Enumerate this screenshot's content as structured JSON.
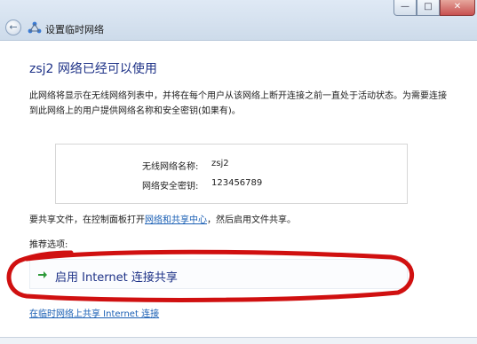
{
  "window": {
    "title": "设置临时网络",
    "controls": {
      "minimize": "—",
      "maximize": "□",
      "close": "✕"
    }
  },
  "content": {
    "heading": "zsj2 网络已经可以使用",
    "paragraph": "此网络将显示在无线网络列表中，并将在每个用户从该网络上断开连接之前一直处于活动状态。为需要连接到此网络上的用户提供网络名称和安全密钥(如果有)。",
    "network_info": {
      "name_label": "无线网络名称:",
      "name_value": "zsj2",
      "key_label": "网络安全密钥:",
      "key_value": "123456789"
    },
    "share_files": {
      "prefix": "要共享文件，在控制面板打开",
      "link": "网络和共享中心",
      "suffix": "，然后启用文件共享。"
    },
    "recommended_label": "推荐选项:",
    "option_label": "启用 Internet 连接共享",
    "bottom_link": "在临时网络上共享 Internet 连接"
  },
  "icons": {
    "back": "back-arrow-icon",
    "network": "network-icon",
    "option": "green-arrow-icon"
  },
  "colors": {
    "heading": "#1e3287",
    "link": "#1a5fb4",
    "annotation": "#d01010",
    "option_arrow": "#2e9a3a"
  }
}
